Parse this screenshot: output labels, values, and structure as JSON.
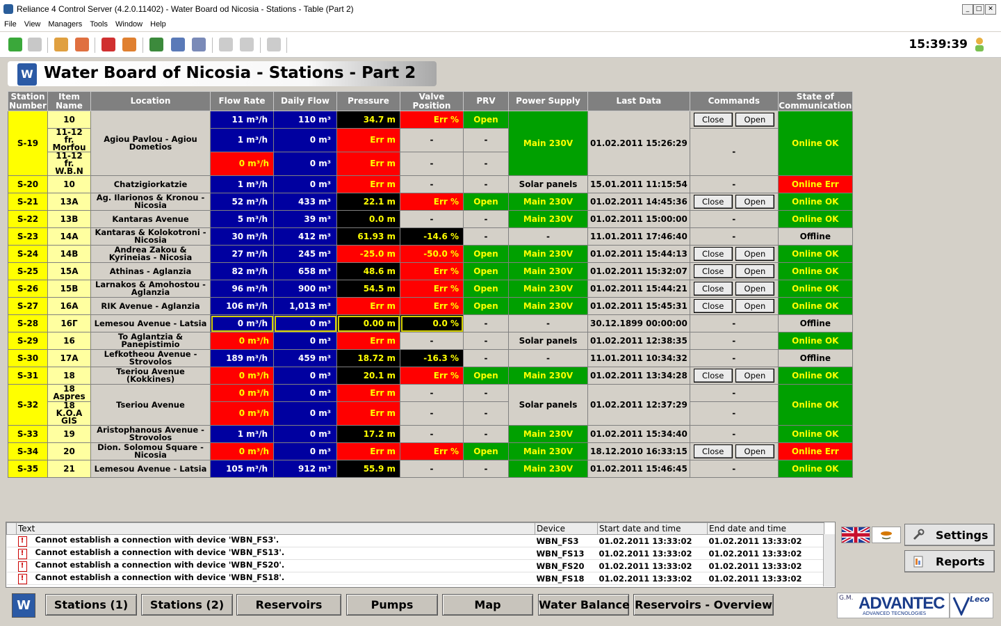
{
  "window": {
    "title": "Reliance 4 Control Server (4.2.0.11402) - Water Board od Nicosia - Stations - Table (Part 2)",
    "minimize": "_",
    "maximize": "□",
    "close": "✕"
  },
  "menu": [
    "File",
    "View",
    "Managers",
    "Tools",
    "Window",
    "Help"
  ],
  "clock": "15:39:39",
  "header": {
    "title": "Water Board of Nicosia - Stations - Part 2",
    "logo": "W"
  },
  "columns": [
    "Station Number",
    "Item Name",
    "Location",
    "Flow Rate",
    "Daily Flow",
    "Pressure",
    "Valve Position",
    "PRV",
    "Power Supply",
    "Last Data",
    "Commands",
    "State of Communication"
  ],
  "buttons": {
    "close": "Close",
    "open": "Open"
  },
  "rows": [
    {
      "station": "S-19",
      "item": "10",
      "location": "Agiou Pavlou - Agiou Dometios",
      "flow": "11 m³/h",
      "daily": "110 m³",
      "pressure": "34.7 m",
      "valve": "Err %",
      "prv": "Open",
      "power": "Main 230V",
      "last": "01.02.2011 15:26:29",
      "cmd": "buttons",
      "state": "Online OK"
    },
    {
      "item": "11-12 fr. Morfou",
      "flow": "1 m³/h",
      "daily": "0 m³",
      "pressure": "Err m",
      "valve": "-",
      "prv": "-",
      "cmd": "-"
    },
    {
      "item": "11-12 fr. W.B.N",
      "flow": "0 m³/h",
      "daily": "0 m³",
      "pressure": "Err m",
      "valve": "-",
      "prv": "-"
    },
    {
      "station": "S-20",
      "item": "10",
      "location": "Chatzigiorkatzie",
      "flow": "1 m³/h",
      "daily": "0 m³",
      "pressure": "Err m",
      "valve": "-",
      "prv": "-",
      "power": "Solar panels",
      "last": "15.01.2011 11:15:54",
      "cmd": "-",
      "state": "Online Err"
    },
    {
      "station": "S-21",
      "item": "13A",
      "location": "Ag. Ilarionos & Kronou - Nicosia",
      "flow": "52 m³/h",
      "daily": "433 m³",
      "pressure": "22.1 m",
      "valve": "Err %",
      "prv": "Open",
      "power": "Main 230V",
      "last": "01.02.2011 14:45:36",
      "cmd": "buttons",
      "state": "Online OK"
    },
    {
      "station": "S-22",
      "item": "13B",
      "location": "Kantaras Avenue",
      "flow": "5 m³/h",
      "daily": "39 m³",
      "pressure": "0.0 m",
      "valve": "-",
      "prv": "-",
      "power": "Main 230V",
      "last": "01.02.2011 15:00:00",
      "cmd": "-",
      "state": "Online OK"
    },
    {
      "station": "S-23",
      "item": "14A",
      "location": "Kantaras & Kolokotroni - Nicosia",
      "flow": "30 m³/h",
      "daily": "412 m³",
      "pressure": "61.93 m",
      "valve": "-14.6 %",
      "prv": "-",
      "power": "-",
      "last": "11.01.2011 17:46:40",
      "cmd": "-",
      "state": "Offline"
    },
    {
      "station": "S-24",
      "item": "14B",
      "location": "Andrea Zakou & Kyrineias - Nicosia",
      "flow": "27 m³/h",
      "daily": "245 m³",
      "pressure": "-25.0 m",
      "valve": "-50.0 %",
      "prv": "Open",
      "power": "Main 230V",
      "last": "01.02.2011 15:44:13",
      "cmd": "buttons",
      "state": "Online OK"
    },
    {
      "station": "S-25",
      "item": "15A",
      "location": "Athinas - Aglanzia",
      "flow": "82 m³/h",
      "daily": "658 m³",
      "pressure": "48.6 m",
      "valve": "Err %",
      "prv": "Open",
      "power": "Main 230V",
      "last": "01.02.2011 15:32:07",
      "cmd": "buttons",
      "state": "Online OK"
    },
    {
      "station": "S-26",
      "item": "15B",
      "location": "Larnakos & Amohostou - Aglanzia",
      "flow": "96 m³/h",
      "daily": "900 m³",
      "pressure": "54.5 m",
      "valve": "Err %",
      "prv": "Open",
      "power": "Main 230V",
      "last": "01.02.2011 15:44:21",
      "cmd": "buttons",
      "state": "Online OK"
    },
    {
      "station": "S-27",
      "item": "16A",
      "location": "RIK Avenue - Aglanzia",
      "flow": "106 m³/h",
      "daily": "1,013 m³",
      "pressure": "Err m",
      "valve": "Err %",
      "prv": "Open",
      "power": "Main 230V",
      "last": "01.02.2011 15:45:31",
      "cmd": "buttons",
      "state": "Online OK"
    },
    {
      "station": "S-28",
      "item": "16Γ",
      "location": "Lemesou Avenue - Latsia",
      "flow": "0 m³/h",
      "daily": "0 m³",
      "pressure": "0.00 m",
      "valve": "0.0 %",
      "prv": "-",
      "power": "-",
      "last": "30.12.1899 00:00:00",
      "cmd": "-",
      "state": "Offline"
    },
    {
      "station": "S-29",
      "item": "16",
      "location": "To Aglantzia & Panepistimio",
      "flow": "0 m³/h",
      "daily": "0 m³",
      "pressure": "Err m",
      "valve": "-",
      "prv": "-",
      "power": "Solar panels",
      "last": "01.02.2011 12:38:35",
      "cmd": "-",
      "state": "Online OK"
    },
    {
      "station": "S-30",
      "item": "17A",
      "location": "Lefkotheou Avenue - Strovolos",
      "flow": "189 m³/h",
      "daily": "459 m³",
      "pressure": "18.72 m",
      "valve": "-16.3 %",
      "prv": "-",
      "power": "-",
      "last": "11.01.2011 10:34:32",
      "cmd": "-",
      "state": "Offline"
    },
    {
      "station": "S-31",
      "item": "18",
      "location": "Tseriou Avenue (Kokkines)",
      "flow": "0 m³/h",
      "daily": "0 m³",
      "pressure": "20.1 m",
      "valve": "Err %",
      "prv": "Open",
      "power": "Main 230V",
      "last": "01.02.2011 13:34:28",
      "cmd": "buttons",
      "state": "Online OK"
    },
    {
      "station": "S-32",
      "item": "18 Aspres",
      "location": "Tseriou Avenue",
      "flow": "0 m³/h",
      "daily": "0 m³",
      "pressure": "Err m",
      "valve": "-",
      "prv": "-",
      "power": "Solar panels",
      "last": "01.02.2011 12:37:29",
      "cmd": "-",
      "state": "Online OK"
    },
    {
      "item": "18 K.O.A GIS",
      "flow": "0 m³/h",
      "daily": "0 m³",
      "pressure": "Err m",
      "valve": "-",
      "prv": "-",
      "cmd": "-"
    },
    {
      "station": "S-33",
      "item": "19",
      "location": "Aristophanous Avenue - Strovolos",
      "flow": "1 m³/h",
      "daily": "0 m³",
      "pressure": "17.2 m",
      "valve": "-",
      "prv": "-",
      "power": "Main 230V",
      "last": "01.02.2011 15:34:40",
      "cmd": "-",
      "state": "Online OK"
    },
    {
      "station": "S-34",
      "item": "20",
      "location": "Dion. Solomou Square - Nicosia",
      "flow": "0 m³/h",
      "daily": "0 m³",
      "pressure": "Err m",
      "valve": "Err %",
      "prv": "Open",
      "power": "Main 230V",
      "last": "18.12.2010 16:33:15",
      "cmd": "buttons",
      "state": "Online Err"
    },
    {
      "station": "S-35",
      "item": "21",
      "location": "Lemesou Avenue - Latsia",
      "flow": "105 m³/h",
      "daily": "912 m³",
      "pressure": "55.9 m",
      "valve": "-",
      "prv": "-",
      "power": "Main 230V",
      "last": "01.02.2011 15:46:45",
      "cmd": "-",
      "state": "Online OK"
    }
  ],
  "alarms": {
    "columns": [
      "Text",
      "Device",
      "Start date and time",
      "End date and time"
    ],
    "rows": [
      {
        "text": "Cannot establish a connection with device 'WBN_FS3'.",
        "device": "WBN_FS3",
        "start": "01.02.2011 13:33:02",
        "end": "01.02.2011 13:33:02"
      },
      {
        "text": "Cannot establish a connection with device 'WBN_FS13'.",
        "device": "WBN_FS13",
        "start": "01.02.2011 13:33:02",
        "end": "01.02.2011 13:33:02"
      },
      {
        "text": "Cannot establish a connection with device 'WBN_FS20'.",
        "device": "WBN_FS20",
        "start": "01.02.2011 13:33:02",
        "end": "01.02.2011 13:33:02"
      },
      {
        "text": "Cannot establish a connection with device 'WBN_FS18'.",
        "device": "WBN_FS18",
        "start": "01.02.2011 13:33:02",
        "end": "01.02.2011 13:33:02"
      }
    ]
  },
  "side": {
    "settings": "Settings",
    "reports": "Reports"
  },
  "nav": [
    "Stations (1)",
    "Stations (2)",
    "Reservoirs",
    "Pumps",
    "Map",
    "Water Balance",
    "Reservoirs - Overview"
  ],
  "brand": {
    "gm": "G.M.",
    "advantec": "ADVANTEC",
    "tag": "ADVANCED TECNOLOGIES",
    "leco": "Leco"
  }
}
